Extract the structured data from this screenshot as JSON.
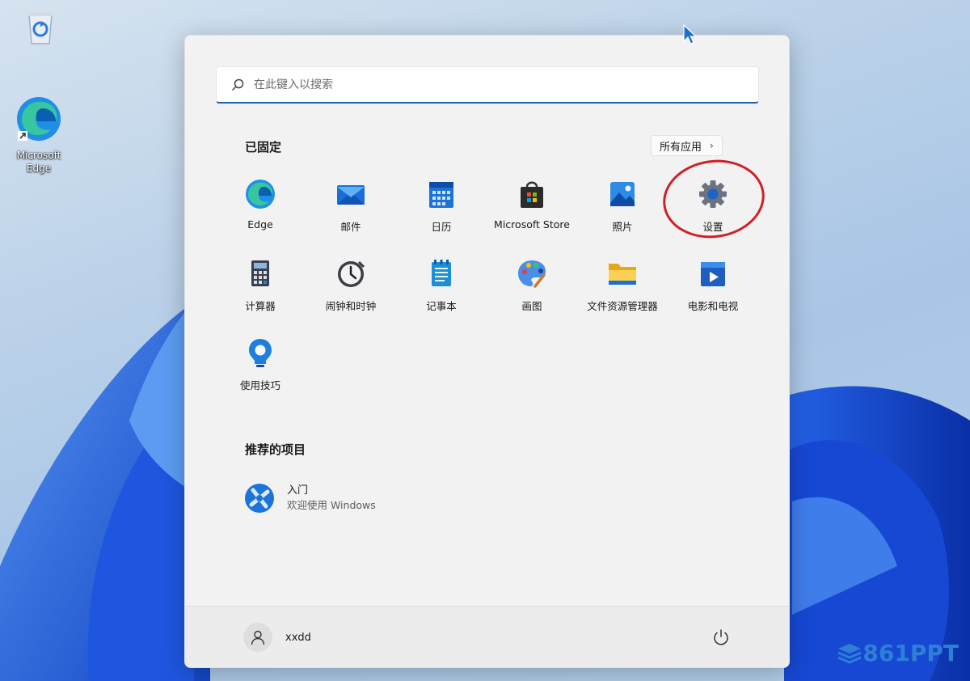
{
  "desktop": {
    "icons": [
      {
        "label": "",
        "icon": "recycle-bin-icon"
      },
      {
        "label": "Microsoft Edge",
        "icon": "edge-icon"
      }
    ]
  },
  "start_menu": {
    "search": {
      "placeholder": "在此键入以搜索"
    },
    "pinned": {
      "title": "已固定",
      "all_apps_label": "所有应用",
      "all_apps_chevron": "›",
      "apps": [
        {
          "label": "Edge",
          "icon": "edge-icon"
        },
        {
          "label": "邮件",
          "icon": "mail-icon"
        },
        {
          "label": "日历",
          "icon": "calendar-icon"
        },
        {
          "label": "Microsoft Store",
          "icon": "store-icon"
        },
        {
          "label": "照片",
          "icon": "photos-icon"
        },
        {
          "label": "设置",
          "icon": "settings-gear-icon"
        },
        {
          "label": "计算器",
          "icon": "calculator-icon"
        },
        {
          "label": "闹钟和时钟",
          "icon": "clock-icon"
        },
        {
          "label": "记事本",
          "icon": "notepad-icon"
        },
        {
          "label": "画图",
          "icon": "paint-palette-icon"
        },
        {
          "label": "文件资源管理器",
          "icon": "folder-icon"
        },
        {
          "label": "电影和电视",
          "icon": "movies-tv-icon"
        },
        {
          "label": "使用技巧",
          "icon": "tips-bulb-icon"
        }
      ]
    },
    "recommended": {
      "title": "推荐的项目",
      "items": [
        {
          "title": "入门",
          "subtitle": "欢迎使用 Windows",
          "icon": "get-started-icon"
        }
      ]
    },
    "footer": {
      "username": "xxdd",
      "power_icon": "power-icon"
    }
  },
  "annotation": {
    "color": "#d01f26",
    "target": "设置"
  },
  "watermark": {
    "text": "861PPT"
  },
  "colors": {
    "accent": "#1d5fa8",
    "brand_blue": "#2e7fd6"
  }
}
